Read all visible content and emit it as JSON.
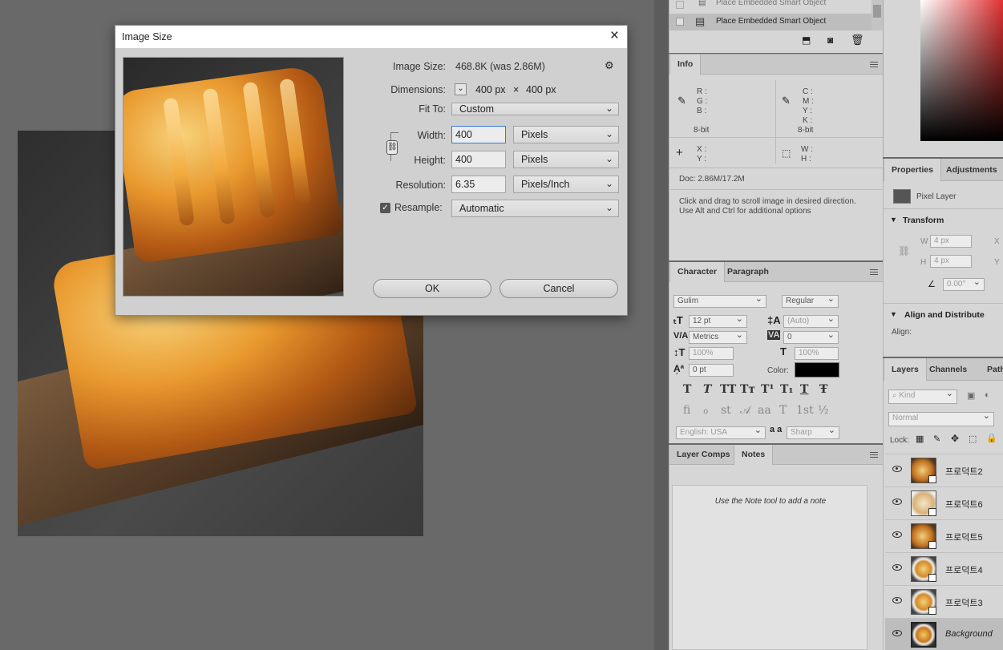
{
  "dialog": {
    "title": "Image Size",
    "image_size_label": "Image Size:",
    "image_size_value": "468.8K (was 2.86M)",
    "dimensions_label": "Dimensions:",
    "dimensions_w": "400 px",
    "dimensions_x": "×",
    "dimensions_h": "400 px",
    "fit_to_label": "Fit To:",
    "fit_to_value": "Custom",
    "width_label": "Width:",
    "width_value": "400",
    "width_unit": "Pixels",
    "height_label": "Height:",
    "height_value": "400",
    "height_unit": "Pixels",
    "resolution_label": "Resolution:",
    "resolution_value": "6.35",
    "resolution_unit": "Pixels/Inch",
    "resample_label": "Resample:",
    "resample_value": "Automatic",
    "ok_label": "OK",
    "cancel_label": "Cancel"
  },
  "history": {
    "items": [
      "Place Embedded Smart Object",
      "Place Embedded Smart Object"
    ]
  },
  "info": {
    "tab": "Info",
    "rgb_labels": [
      "R :",
      "G :",
      "B :"
    ],
    "cmyk_labels": [
      "C :",
      "M :",
      "Y :",
      "K :"
    ],
    "bit_left": "8-bit",
    "bit_right": "8-bit",
    "xy_labels": [
      "X :",
      "Y :"
    ],
    "wh_labels": [
      "W :",
      "H :"
    ],
    "doc": "Doc: 2.86M/17.2M",
    "hint_line1": "Click and drag to scroll image in desired direction.",
    "hint_line2": "Use Alt and Ctrl for additional options"
  },
  "character": {
    "tabs": [
      "Character",
      "Paragraph"
    ],
    "font_family": "Gulim",
    "font_style": "Regular",
    "size": "12 pt",
    "leading": "(Auto)",
    "kerning": "Metrics",
    "tracking": "0",
    "vscale": "100%",
    "hscale": "100%",
    "baseline": "0 pt",
    "color_label": "Color:",
    "language": "English: USA",
    "aa_label": "a a",
    "aa_value": "Sharp",
    "style_glyphs": [
      "T",
      "T",
      "TT",
      "Tт",
      "T¹",
      "T₁",
      "T",
      "Ŧ"
    ],
    "ot_glyphs": [
      "fi",
      "ℴ",
      "st",
      "𝒜",
      "aa",
      "T",
      "1st",
      "½"
    ]
  },
  "notes": {
    "tabs": [
      "Layer Comps",
      "Notes"
    ],
    "hint": "Use the Note tool to add a note"
  },
  "properties": {
    "tabs": [
      "Properties",
      "Adjustments"
    ],
    "kind": "Pixel Layer",
    "transform_label": "Transform",
    "w_label": "W",
    "w_value": "4 px",
    "h_label": "H",
    "h_value": "4 px",
    "x_label": "X",
    "y_label": "Y",
    "angle": "0.00°",
    "align_label": "Align and Distribute",
    "align_sub": "Align:"
  },
  "layers": {
    "tabs": [
      "Layers",
      "Channels",
      "Paths"
    ],
    "kind_placeholder": "Kind",
    "blend_mode": "Normal",
    "lock_label": "Lock:",
    "items": [
      {
        "name": "프로덕트2"
      },
      {
        "name": "프로덕트6"
      },
      {
        "name": "프로덕트5"
      },
      {
        "name": "프로덕트4"
      },
      {
        "name": "프로덕트3"
      },
      {
        "name": "Background"
      }
    ]
  },
  "colors": {
    "accent_input": "#3a78d8",
    "panel_bg": "#d6d6d6",
    "canvas_bg": "#696969",
    "char_color": "#000000"
  }
}
